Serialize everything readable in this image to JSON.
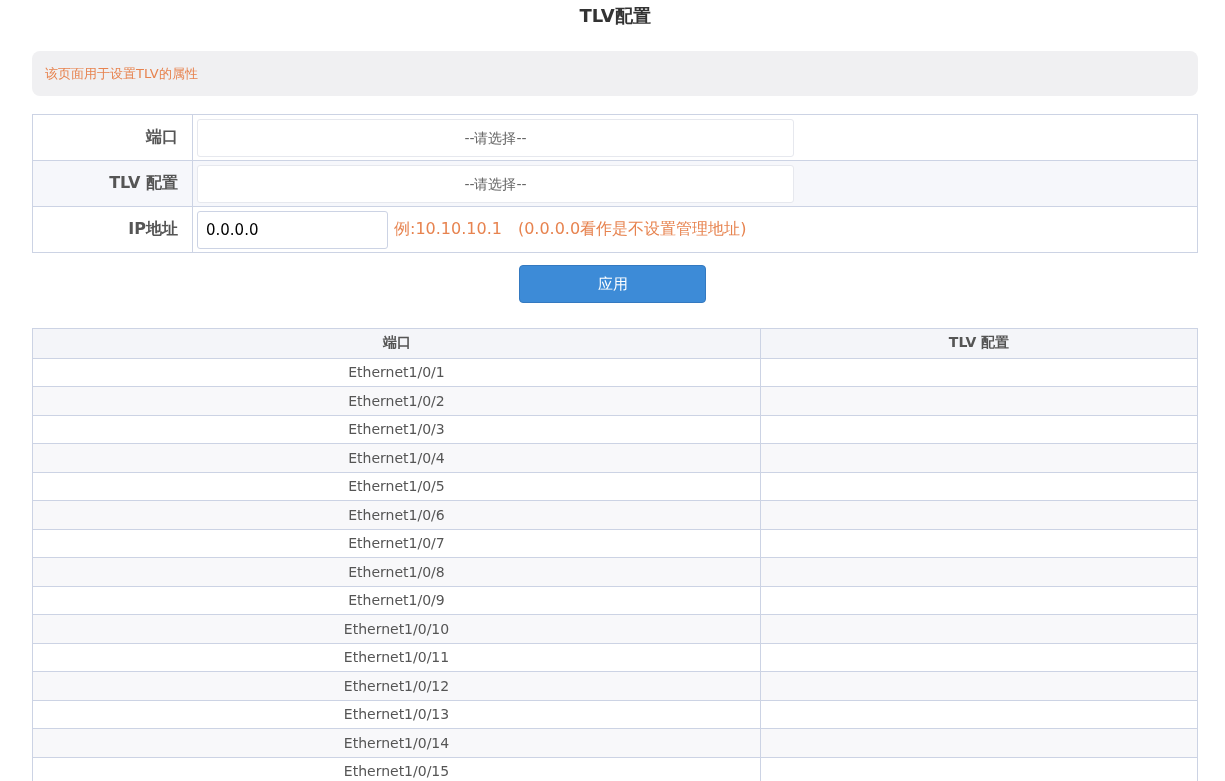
{
  "title": "TLV配置",
  "info": "该页面用于设置TLV的属性",
  "form": {
    "rows": [
      {
        "kind": "select",
        "label": "端口",
        "placeholder": "--请选择--"
      },
      {
        "kind": "select",
        "label": "TLV 配置",
        "placeholder": "--请选择--"
      },
      {
        "kind": "input",
        "label": "IP地址",
        "value": "0.0.0.0",
        "hint": "例:10.10.10.1　(0.0.0.0看作是不设置管理地址)"
      }
    ]
  },
  "apply_button": "应用",
  "table": {
    "columns": [
      "端口",
      "TLV 配置"
    ],
    "rows": [
      {
        "port": "Ethernet1/0/1"
      },
      {
        "port": "Ethernet1/0/2"
      },
      {
        "port": "Ethernet1/0/3"
      },
      {
        "port": "Ethernet1/0/4"
      },
      {
        "port": "Ethernet1/0/5"
      },
      {
        "port": "Ethernet1/0/6"
      },
      {
        "port": "Ethernet1/0/7"
      },
      {
        "port": "Ethernet1/0/8"
      },
      {
        "port": "Ethernet1/0/9"
      },
      {
        "port": "Ethernet1/0/10"
      },
      {
        "port": "Ethernet1/0/11"
      },
      {
        "port": "Ethernet1/0/12"
      },
      {
        "port": "Ethernet1/0/13"
      },
      {
        "port": "Ethernet1/0/14"
      },
      {
        "port": "Ethernet1/0/15"
      }
    ]
  }
}
